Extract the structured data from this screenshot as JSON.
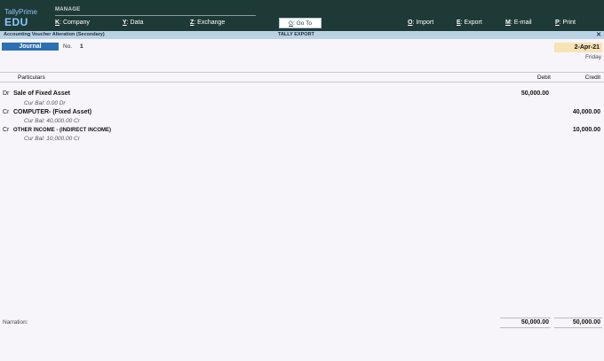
{
  "app": {
    "brand_top": "TallyPrime",
    "brand_edition": "EDU"
  },
  "topbar": {
    "section": "MANAGE",
    "menu": [
      {
        "key": "K",
        "label": ": Company"
      },
      {
        "key": "Y",
        "label": ": Data"
      },
      {
        "key": "Z",
        "label": ": Exchange"
      }
    ],
    "goto": {
      "key": "G",
      "label": ": Go To"
    },
    "right_menu": [
      {
        "key": "O",
        "label": ": Import"
      },
      {
        "key": "E",
        "label": ": Export"
      },
      {
        "key": "M",
        "label": ": E-mail"
      },
      {
        "key": "P",
        "label": ": Print"
      }
    ]
  },
  "titlebar": {
    "title": "Accounting Voucher Alteration (Secondary)",
    "company": "TALLY EXPORT",
    "close_glyph": "✕"
  },
  "voucher": {
    "type": "Journal",
    "no_label": "No.",
    "no_value": "1",
    "date": "2-Apr-21",
    "day": "Friday"
  },
  "columns": {
    "particulars": "Particulars",
    "debit": "Debit",
    "credit": "Credit"
  },
  "entries": [
    {
      "drcr": "Dr",
      "ledger": "Sale of Fixed Asset",
      "cur_bal": "Cur Bal:  0.00 Dr",
      "debit": "50,000.00",
      "credit": ""
    },
    {
      "drcr": "Cr",
      "ledger": "COMPUTER- (Fixed Asset)",
      "cur_bal": "Cur Bal:  40,000.00 Cr",
      "debit": "",
      "credit": "40,000.00"
    },
    {
      "drcr": "Cr",
      "ledger": "OTHER INCOME - (INDIRECT INCOME)",
      "cur_bal": "Cur Bal:  10,000.00 Cr",
      "debit": "",
      "credit": "10,000.00"
    }
  ],
  "footer": {
    "narration_label": "Narration:",
    "total_debit": "50,000.00",
    "total_credit": "50,000.00"
  }
}
